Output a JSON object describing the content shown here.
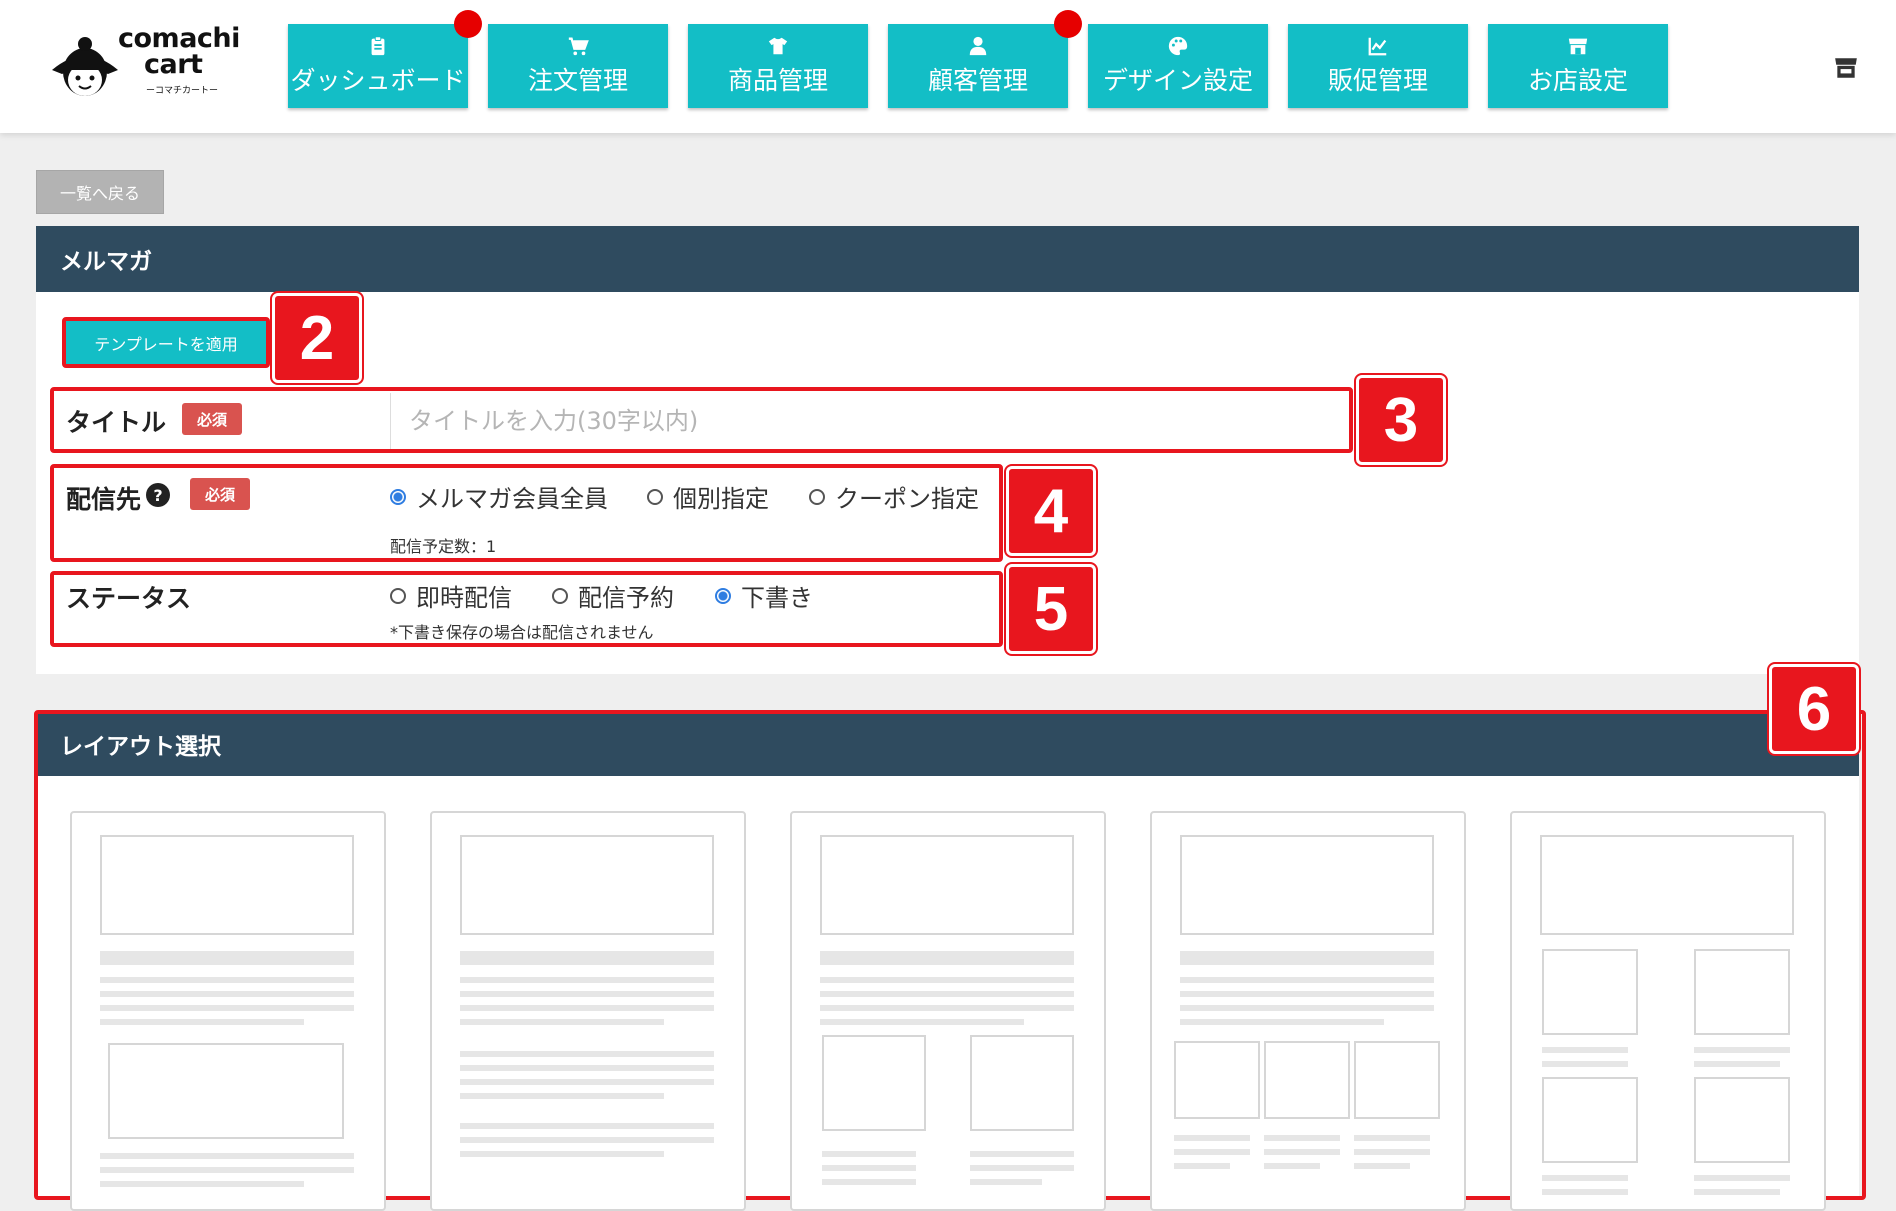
{
  "logo": {
    "line1": "comachi",
    "line2": "cart",
    "sub": "ーコマチカートー"
  },
  "nav": [
    {
      "label": "ダッシュボード",
      "icon": "clipboard-icon",
      "notify": true
    },
    {
      "label": "注文管理",
      "icon": "cart-icon",
      "notify": false
    },
    {
      "label": "商品管理",
      "icon": "tshirt-icon",
      "notify": false
    },
    {
      "label": "顧客管理",
      "icon": "user-icon",
      "notify": true
    },
    {
      "label": "デザイン設定",
      "icon": "palette-icon",
      "notify": false
    },
    {
      "label": "販促管理",
      "icon": "chart-line-icon",
      "notify": false
    },
    {
      "label": "お店設定",
      "icon": "store-icon",
      "notify": false
    }
  ],
  "back_label": "一覧へ戻る",
  "panel": {
    "title": "メルマガ",
    "template_button": "テンプレートを適用",
    "title_label": "タイトル",
    "required": "必須",
    "title_placeholder": "タイトルを入力(30字以内)",
    "dest_label": "配信先",
    "dest_options": [
      "メルマガ会員全員",
      "個別指定",
      "クーポン指定"
    ],
    "dest_selected": 0,
    "dest_count": "配信予定数：1",
    "status_label": "ステータス",
    "status_options": [
      "即時配信",
      "配信予約",
      "下書き"
    ],
    "status_selected": 2,
    "status_note": "*下書き保存の場合は配信されません"
  },
  "annotations": [
    "2",
    "3",
    "4",
    "5",
    "6"
  ],
  "layout_panel": {
    "title": "レイアウト選択"
  },
  "colors": {
    "teal": "#13bec6",
    "header": "#2f4b5f",
    "annotation": "#e8161e",
    "notify": "#e60000"
  }
}
